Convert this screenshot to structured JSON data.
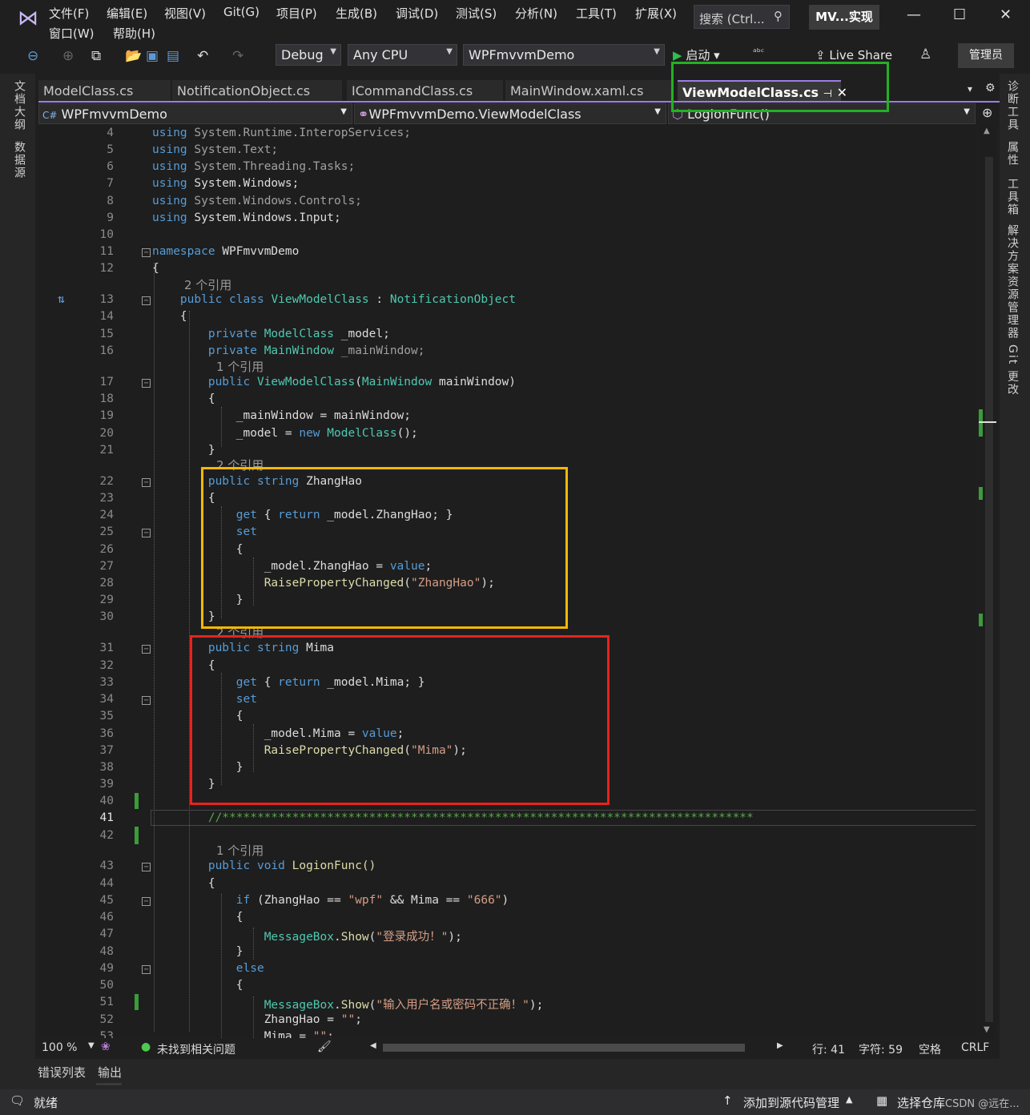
{
  "menu": {
    "file": "文件(F)",
    "edit": "编辑(E)",
    "view": "视图(V)",
    "git": "Git(G)",
    "project": "项目(P)",
    "build": "生成(B)",
    "debug": "调试(D)",
    "test": "测试(S)",
    "analyze": "分析(N)",
    "tools": "工具(T)",
    "extensions": "扩展(X)",
    "window": "窗口(W)",
    "help": "帮助(H)"
  },
  "search": {
    "text": "搜索 (Ctrl..."
  },
  "solution_title": "MV...实现",
  "toolbar": {
    "config": "Debug",
    "platform": "Any CPU",
    "project": "WPFmvvmDemo",
    "start": "启动",
    "live_share": "Live Share",
    "admin": "管理员"
  },
  "left_panels": [
    "文档大纲",
    "数据源"
  ],
  "right_panels": [
    "诊断工具",
    "属性",
    "工具箱",
    "解决方案资源管理器",
    "Git 更改"
  ],
  "tabs": [
    "ModelClass.cs",
    "NotificationObject.cs",
    "ICommandClass.cs",
    "MainWindow.xaml.cs",
    "ViewModelClass.cs"
  ],
  "nav": {
    "project": "WPFmvvmDemo",
    "type": "WPFmvvmDemo.ViewModelClass",
    "member": "LogionFunc()"
  },
  "refs": {
    "r2": "2 个引用",
    "r1": "1 个引用"
  },
  "code": {
    "l4": "System.Runtime.InteropServices;",
    "l5": "System.Text;",
    "l6": "System.Threading.Tasks;",
    "l7": "System.Windows;",
    "l8": "System.Windows.Controls;",
    "l9": "System.Windows.Input;",
    "using": "using",
    "namespace": "namespace",
    "ns_name": "WPFmvvmDemo",
    "public": "public",
    "private": "private",
    "class": "class",
    "string": "string",
    "void": "void",
    "new": "new",
    "get": "get",
    "set": "set",
    "return": "return",
    "value": "value",
    "if": "if",
    "else": "else",
    "vm": "ViewModelClass",
    "notif": "NotificationObject",
    "model_cls": "ModelClass",
    "mainwin_cls": "MainWindow",
    "f_model": "_model;",
    "f_mainwin": "_mainWindow;",
    "param": "mainWindow)",
    "assign1": "_mainWindow = ",
    "assign1b": "mainWindow;",
    "assign2": "_model = ",
    "zhanghao": "ZhangHao",
    "mima": "Mima",
    "get_zh": "_model.ZhangHao; }",
    "get_mm": "_model.Mima; }",
    "set_zh": "_model.ZhangHao = ",
    "set_mm": "_model.Mima = ",
    "raise": "RaisePropertyChanged",
    "s_zh": "\"ZhangHao\"",
    "s_mm": "\"Mima\"",
    "comment": "//****************************************************************************",
    "login": "LogionFunc()",
    "if_cond_a": "(ZhangHao == ",
    "s_wpf": "\"wpf\"",
    "if_and": " && Mima == ",
    "s_666": "\"666\"",
    "msgbox": "MessageBox",
    "show": "Show",
    "s_ok": "\"登录成功！\"",
    "s_err": "\"输入用户名或密码不正确！\"",
    "zh_clear": "ZhangHao = ",
    "mm_clear": "Mima = ",
    "s_empty": "\"\""
  },
  "status": {
    "zoom": "100 %",
    "issues": "未找到相关问题",
    "line": "行: 41",
    "char": "字符: 59",
    "space": "空格",
    "crlf": "CRLF"
  },
  "bottom_tabs": [
    "错误列表",
    "输出"
  ],
  "statusbar": {
    "ready": "就绪",
    "add_source": "添加到源代码管理",
    "select_repo": "选择仓库",
    "watermark": "CSDN @远在..."
  },
  "colors": {
    "accent": "#9d7ce8",
    "green_box": "#22b122",
    "orange_box": "#f5b800",
    "red_box": "#e8231c"
  }
}
